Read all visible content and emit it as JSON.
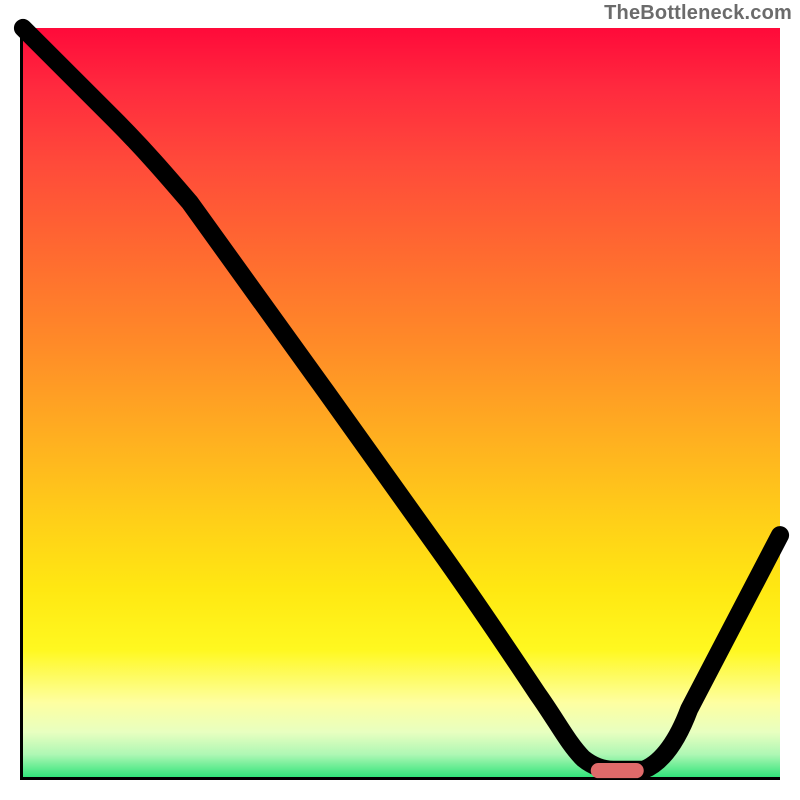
{
  "watermark": "TheBottleneck.com",
  "colors": {
    "axis": "#000000",
    "watermark": "#6b6b6b",
    "highlight": "#e06a6a",
    "gradient_top": "#ff0a3a",
    "gradient_bottom": "#32e47a"
  },
  "chart_data": {
    "type": "line",
    "title": "",
    "xlabel": "",
    "ylabel": "",
    "xlim": [
      0,
      100
    ],
    "ylim": [
      0,
      100
    ],
    "grid": false,
    "legend": false,
    "background": "vertical-gradient",
    "series": [
      {
        "name": "bottleneck-curve",
        "x": [
          0,
          12,
          22,
          40,
          55,
          68,
          74,
          78,
          82,
          88,
          100
        ],
        "values": [
          100,
          88,
          77,
          52,
          31,
          12,
          3.5,
          2,
          2,
          10,
          33
        ]
      }
    ],
    "annotations": [
      {
        "name": "min-plateau-marker",
        "x_start": 75,
        "x_end": 82,
        "y": 2
      }
    ]
  }
}
